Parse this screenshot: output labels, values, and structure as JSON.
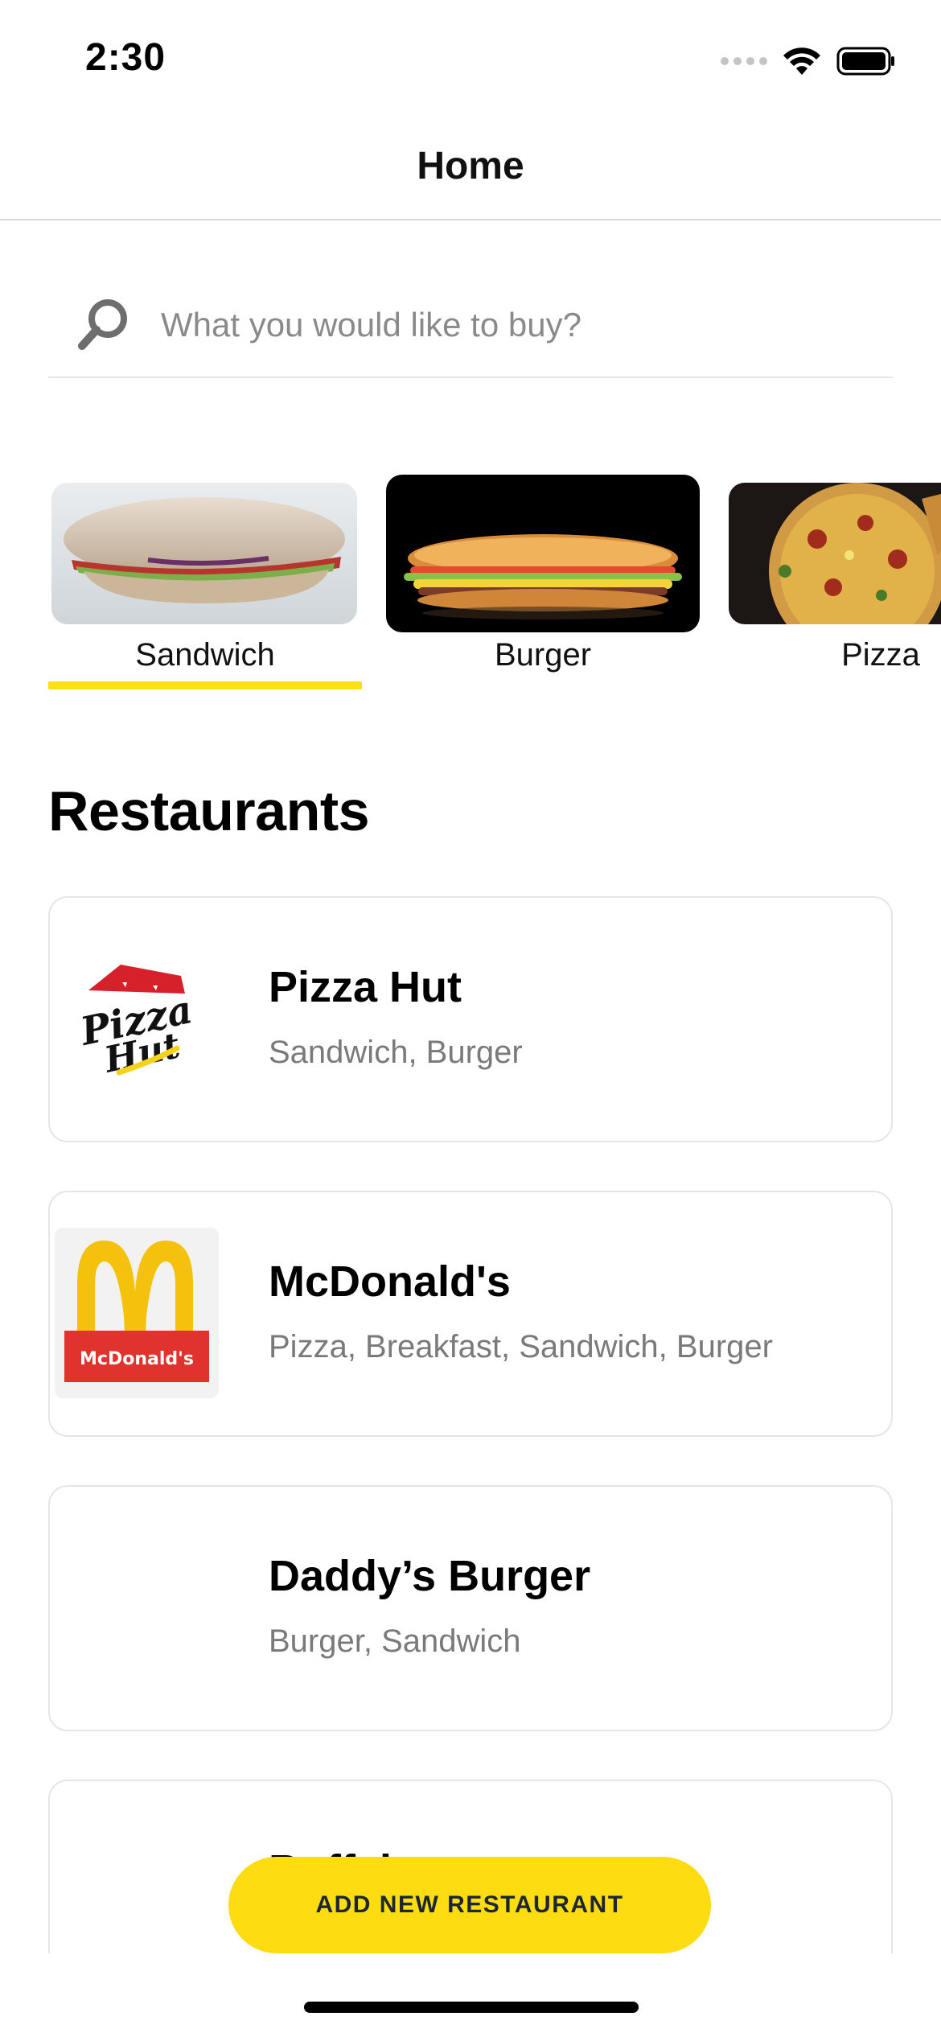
{
  "status_bar": {
    "time": "2:30",
    "icons": [
      "signal-dots-icon",
      "wifi-icon",
      "battery-icon"
    ]
  },
  "nav": {
    "title": "Home"
  },
  "search": {
    "placeholder": "What you would like to buy?",
    "value": "",
    "icon": "search-icon"
  },
  "categories": [
    {
      "label": "Sandwich",
      "selected": true
    },
    {
      "label": "Burger",
      "selected": false
    },
    {
      "label": "Pizza",
      "selected": false
    }
  ],
  "restaurants_title": "Restaurants",
  "restaurants": [
    {
      "name": "Pizza Hut",
      "tags": "Sandwich, Burger",
      "logo": "pizza-hut-logo"
    },
    {
      "name": "McDonald's",
      "tags": "Pizza, Breakfast, Sandwich, Burger",
      "logo": "mcdonalds-logo"
    },
    {
      "name": "Daddy’s Burger",
      "tags": "Burger, Sandwich",
      "logo": ""
    },
    {
      "name": "Buffalo",
      "tags": "",
      "logo": ""
    }
  ],
  "add_button_label": "ADD NEW RESTAURANT",
  "colors": {
    "accent": "#FDDC12",
    "muted_text": "#7A7A7A",
    "card_border": "#E6E6E6"
  }
}
